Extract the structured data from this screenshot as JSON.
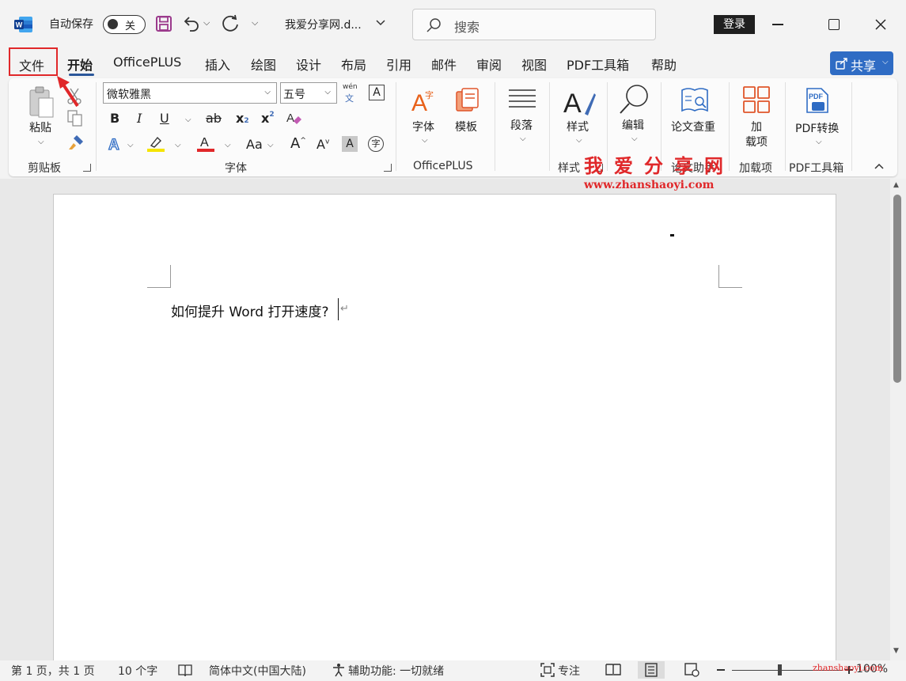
{
  "titlebar": {
    "autosave_label": "自动保存",
    "autosave_state": "关",
    "doc_title": "我爱分享网.d...",
    "search_placeholder": "搜索",
    "login_label": "登录"
  },
  "tabs": [
    {
      "label": "文件"
    },
    {
      "label": "开始"
    },
    {
      "label": "OfficePLUS"
    },
    {
      "label": "插入"
    },
    {
      "label": "绘图"
    },
    {
      "label": "设计"
    },
    {
      "label": "布局"
    },
    {
      "label": "引用"
    },
    {
      "label": "邮件"
    },
    {
      "label": "审阅"
    },
    {
      "label": "视图"
    },
    {
      "label": "PDF工具箱"
    },
    {
      "label": "帮助"
    }
  ],
  "share_label": "共享",
  "ribbon": {
    "clipboard": {
      "paste_label": "粘贴",
      "group_label": "剪贴板"
    },
    "font": {
      "font_name": "微软雅黑",
      "font_size": "五号",
      "group_label": "字体",
      "bold": "B",
      "italic": "I",
      "underline": "U",
      "strike": "ab",
      "subscript": "x",
      "superscript": "x",
      "grow": "A",
      "shrink": "A",
      "change_case": "Aa",
      "char_shading": "A",
      "enclose": "字",
      "phonetic_top": "wén",
      "phonetic_bottom": "文"
    },
    "officeplus": {
      "font_label": "字体",
      "template_label": "模板",
      "group_label": "OfficePLUS"
    },
    "paragraph": {
      "label": "段落"
    },
    "styles": {
      "label": "样式",
      "group_label": "样式"
    },
    "editing": {
      "label": "编辑"
    },
    "paper": {
      "label": "论文查重",
      "group_label": "论文助手"
    },
    "addins": {
      "label_line1": "加",
      "label_line2": "载项",
      "group_label": "加载项"
    },
    "pdf": {
      "label": "PDF转换",
      "group_label": "PDF工具箱"
    }
  },
  "document": {
    "text": "如何提升 Word 打开速度?",
    "para_mark": "↵"
  },
  "watermark": {
    "cn": "我爱分享网",
    "url": "www.zhanshaoyi.com",
    "url_small": "zhanshaoyi.com"
  },
  "statusbar": {
    "page": "第 1 页，共 1 页",
    "words": "10 个字",
    "language": "简体中文(中国大陆)",
    "accessibility": "辅助功能: 一切就绪",
    "focus": "专注",
    "zoom": "100%"
  },
  "colors": {
    "accent": "#2b579a",
    "highlight_red": "#e0282a",
    "share_blue": "#2f6cc4"
  }
}
